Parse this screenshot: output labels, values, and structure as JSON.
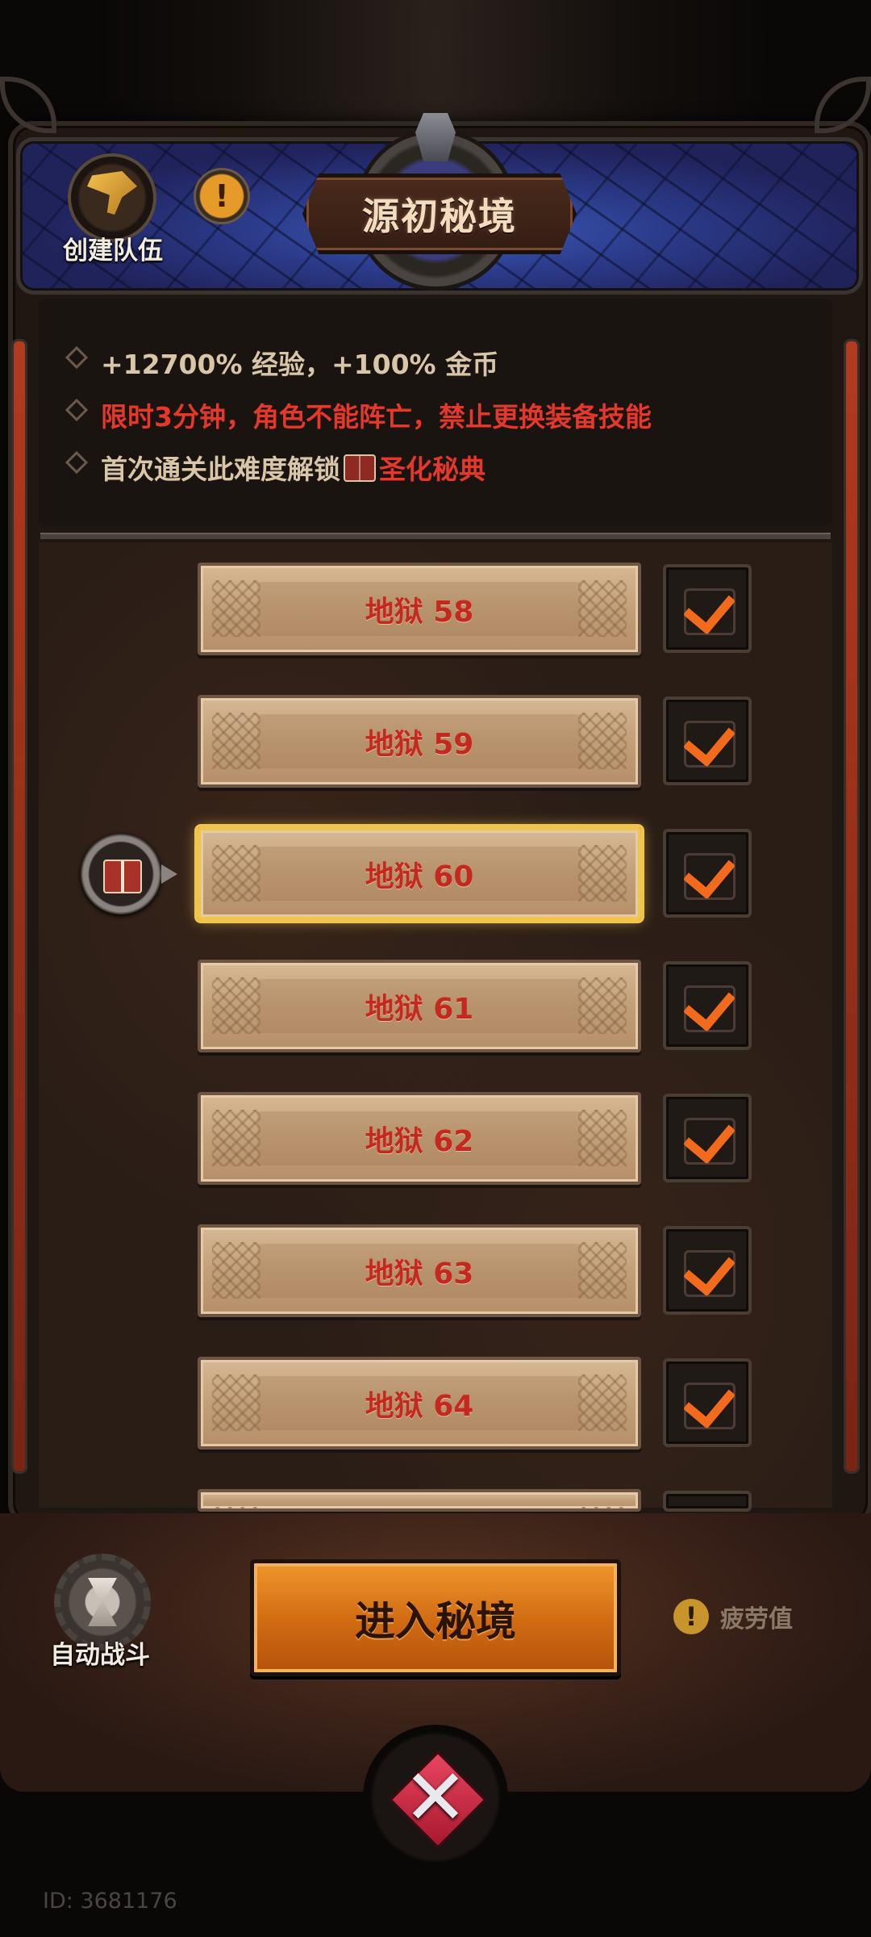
{
  "header": {
    "title": "源初秘境",
    "team_label": "创建队伍",
    "info_icon": "!"
  },
  "info": {
    "line1": "+12700% 经验，+100% 金币",
    "line2": "限时3分钟，角色不能阵亡，禁止更换装备技能",
    "line3_prefix": "首次通关此难度解锁",
    "line3_reward": "圣化秘典"
  },
  "levels": [
    {
      "label": "地狱 58",
      "checked": true
    },
    {
      "label": "地狱 59",
      "checked": true
    },
    {
      "label": "地狱 60",
      "checked": true,
      "selected": true
    },
    {
      "label": "地狱 61",
      "checked": true
    },
    {
      "label": "地狱 62",
      "checked": true
    },
    {
      "label": "地狱 63",
      "checked": true
    },
    {
      "label": "地狱 64",
      "checked": true
    }
  ],
  "footer": {
    "auto_battle_label": "自动战斗",
    "enter_label": "进入秘境",
    "fatigue_label": "疲劳值",
    "fatigue_icon": "!",
    "close_icon": "✕"
  },
  "player_id": "ID: 3681176",
  "colors": {
    "accent_orange": "#d06a12",
    "warning_red": "#e5382a",
    "selected_gold": "#f1c44c",
    "check_orange": "#f26a1b"
  }
}
